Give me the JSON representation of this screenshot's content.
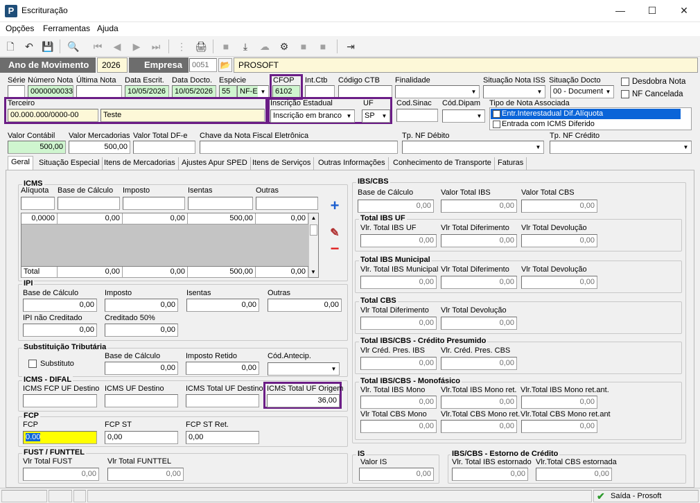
{
  "window": {
    "title": "Escrituração",
    "minimize": "—",
    "maximize": "☐",
    "close": "✕",
    "logo": "P"
  },
  "menu": [
    "Opções",
    "Ferramentas",
    "Ajuda"
  ],
  "header": {
    "ano_label": "Ano de Movimento",
    "ano_value": "2026",
    "empresa_label": "Empresa",
    "empresa_code": "0051",
    "empresa_name": "PROSOFT"
  },
  "row1": {
    "serie_label": "Série",
    "serie_value": "",
    "numero_label": "Número Nota",
    "numero_value": "0000000033",
    "ultima_label": "Última Nota",
    "ultima_value": "",
    "data_escrit_label": "Data Escrit.",
    "data_escrit_value": "10/05/2026",
    "data_docto_label": "Data Docto.",
    "data_docto_value": "10/05/2026",
    "especie_label": "Espécie",
    "especie_code": "55",
    "especie_value": "NF-E",
    "cfop_label": "CFOP",
    "cfop_value": "6102",
    "int_ctb_label": "Int.Ctb",
    "int_ctb_value": "",
    "codigo_ctb_label": "Código CTB",
    "codigo_ctb_value": "",
    "finalidade_label": "Finalidade",
    "finalidade_value": "",
    "situacao_iss_label": "Situação Nota ISS",
    "situacao_iss_value": "",
    "situacao_docto_label": "Situação Docto",
    "situacao_docto_value": "00 - Document",
    "desdobra_label": "Desdobra Nota",
    "nf_cancelada_label": "NF Cancelada"
  },
  "row2": {
    "terceiro_label": "Terceiro",
    "terceiro_cnpj": "00.000.000/0000-00",
    "terceiro_nome": "Teste",
    "ie_label": "Inscrição Estadual",
    "ie_value": "Inscrição em branco",
    "uf_label": "UF",
    "uf_value": "SP",
    "cod_sinac_label": "Cod.Sinac",
    "cod_sinac_value": "",
    "cod_dipam_label": "Cód.Dipam",
    "cod_dipam_value": "",
    "tipo_nota_label": "Tipo de Nota Associada",
    "tipo_nota_items": [
      "Entr.Interestadual Dif.Alíquota",
      "Entrada com ICMS Diferido"
    ]
  },
  "row3": {
    "valor_contabil_label": "Valor Contábil",
    "valor_contabil_value": "500,00",
    "valor_merc_label": "Valor Mercadorias",
    "valor_merc_value": "500,00",
    "valor_dfe_label": "Valor Total DF-e",
    "valor_dfe_value": "",
    "chave_label": "Chave da Nota Fiscal Eletrônica",
    "chave_value": "",
    "tp_debito_label": "Tp. NF Débito",
    "tp_debito_value": "",
    "tp_credito_label": "Tp. NF Crédito",
    "tp_credito_value": ""
  },
  "tabs": [
    "Geral",
    "Situação Especial",
    "Itens de Mercadorias",
    "Ajustes Apur SPED",
    "Itens de Serviços",
    "Outras Informações",
    "Conhecimento de Transporte",
    "Faturas"
  ],
  "icms": {
    "title": "ICMS",
    "cols": [
      "Alíquota",
      "Base de Cálculo",
      "Imposto",
      "Isentas",
      "Outras"
    ],
    "row": [
      "0,0000",
      "0,00",
      "0,00",
      "500,00",
      "0,00"
    ],
    "total_label": "Total",
    "total": [
      "0,00",
      "0,00",
      "500,00",
      "0,00"
    ]
  },
  "ipi": {
    "title": "IPI",
    "base_label": "Base de Cálculo",
    "base_value": "0,00",
    "imposto_label": "Imposto",
    "imposto_value": "0,00",
    "isentas_label": "Isentas",
    "isentas_value": "0,00",
    "outras_label": "Outras",
    "outras_value": "0,00",
    "nao_cred_label": "IPI não Creditado",
    "nao_cred_value": "0,00",
    "cred50_label": "Creditado 50%",
    "cred50_value": "0,00"
  },
  "st": {
    "title": "Substituição Tributária",
    "substituto_label": "Substituto",
    "base_label": "Base de Cálculo",
    "base_value": "0,00",
    "retido_label": "Imposto Retido",
    "retido_value": "0,00",
    "antecip_label": "Cód.Antecip.",
    "antecip_value": ""
  },
  "difal": {
    "title": "ICMS - DIFAL",
    "fcp_label": "ICMS FCP UF Destino",
    "fcp_value": "",
    "uf_dest_label": "ICMS UF Destino",
    "uf_dest_value": "",
    "total_dest_label": "ICMS Total UF Destino",
    "total_dest_value": "",
    "total_orig_label": "ICMS Total UF Origem",
    "total_orig_value": "36,00"
  },
  "fcp": {
    "title": "FCP",
    "fcp_label": "FCP",
    "fcp_value": "0.00",
    "st_label": "FCP ST",
    "st_value": "0,00",
    "st_ret_label": "FCP ST Ret.",
    "st_ret_value": "0,00"
  },
  "fust": {
    "title": "FUST / FUNTTEL",
    "fust_label": "Vlr Total FUST",
    "fust_value": "0,00",
    "funttel_label": "Vlr Total FUNTTEL",
    "funttel_value": "0,00"
  },
  "ibscbs": {
    "title": "IBS/CBS",
    "base_label": "Base de Cálculo",
    "base_value": "0,00",
    "ibs_label": "Valor Total IBS",
    "ibs_value": "0,00",
    "cbs_label": "Valor Total CBS",
    "cbs_value": "0,00",
    "uf": {
      "title": "Total IBS UF",
      "l1": "Vlr. Total IBS UF",
      "v1": "0,00",
      "l2": "Vlr Total Diferimento",
      "v2": "0,00",
      "l3": "Vlr Total Devolução",
      "v3": "0,00"
    },
    "mun": {
      "title": "Total IBS Municipal",
      "l1": "Vlr. Total IBS Municipal",
      "v1": "0,00",
      "l2": "Vlr Total Diferimento",
      "v2": "0,00",
      "l3": "Vlr Total Devolução",
      "v3": "0,00"
    },
    "cbs": {
      "title": "Total CBS",
      "l1": "Vlr Total Diferimento",
      "v1": "0,00",
      "l2": "Vlr Total Devolução",
      "v2": "0,00"
    },
    "presumido": {
      "title": "Total IBS/CBS - Crédito Presumido",
      "l1": "Vlr Créd. Pres. IBS",
      "v1": "0,00",
      "l2": "Vlr. Créd. Pres. CBS",
      "v2": "0,00"
    },
    "mono": {
      "title": "Total IBS/CBS - Monofásico",
      "l1": "Vlr. Total IBS Mono",
      "v1": "0,00",
      "l2": "Vlr.Total IBS Mono ret.",
      "v2": "0,00",
      "l3": "Vlr.Total IBS Mono ret.ant.",
      "v3": "0,00",
      "l4": "Vlr Total CBS Mono",
      "v4": "0,00",
      "l5": "Vlr.Total CBS Mono ret.",
      "v5": "0,00",
      "l6": "Vlr.Total CBS Mono ret.ant",
      "v6": "0,00"
    }
  },
  "is": {
    "title": "IS",
    "label": "Valor IS",
    "value": "0,00"
  },
  "estorno": {
    "title": "IBS/CBS - Estorno de Crédito",
    "l1": "Vlr. Total IBS estornado",
    "v1": "0,00",
    "l2": "Vlr.Total CBS estornada",
    "v2": "0,00"
  },
  "status": {
    "exit_label": "Saída - Prosoft"
  },
  "colors": {
    "purple": "#6b1d86",
    "green_field": "#cff5cf",
    "yellow_field": "#fdf8d8",
    "highlight": "#ffff00",
    "selection": "#0a64d8"
  }
}
